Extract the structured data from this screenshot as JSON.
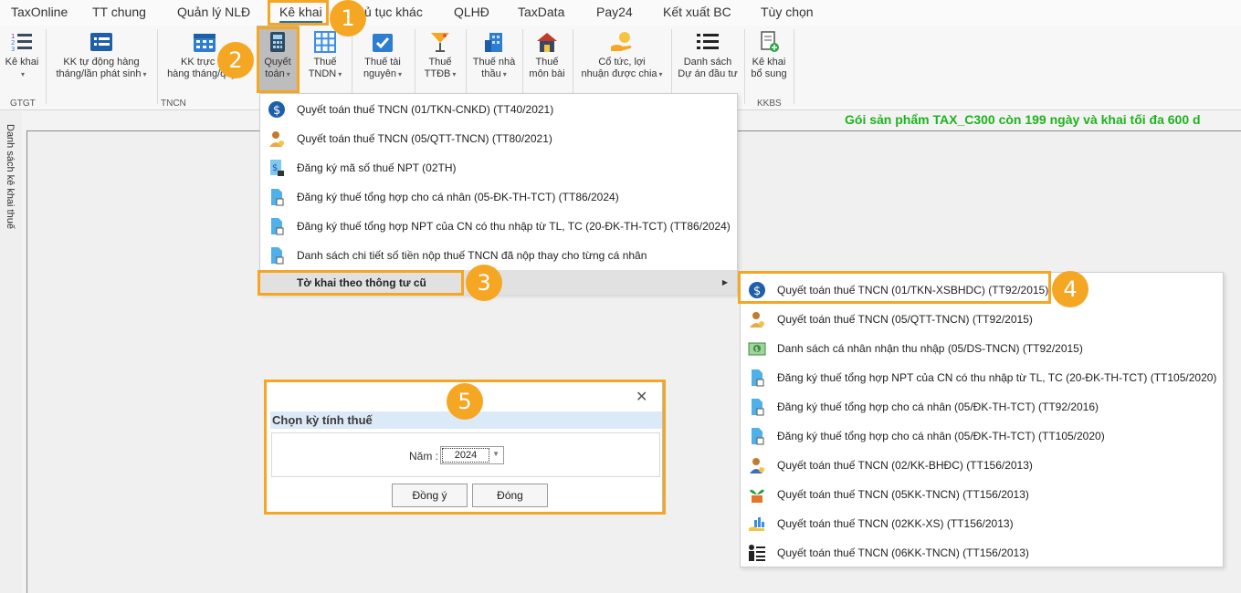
{
  "menubar": {
    "items": [
      "TaxOnline",
      "TT chung",
      "Quản lý NLĐ",
      "Kê khai",
      "ủ tục khác",
      "QLHĐ",
      "TaxData",
      "Pay24",
      "Kết xuất BC",
      "Tùy chọn"
    ]
  },
  "ribbon": {
    "buttons": [
      {
        "line1": "Kê khai",
        "line2": "",
        "icon": "list-numbered-icon"
      },
      {
        "line1": "KK tự động hàng",
        "line2": "tháng/lần phát sinh",
        "icon": "calendar-list-icon"
      },
      {
        "line1": "KK trực tiế",
        "line2": "hàng tháng/quý",
        "icon": "calendar-icon"
      },
      {
        "line1": "Quyết",
        "line2": "toán",
        "icon": "calculator-icon"
      },
      {
        "line1": "Thuế",
        "line2": "TNDN",
        "icon": "grid-icon"
      },
      {
        "line1": "Thuế tài",
        "line2": "nguyên",
        "icon": "calendar-check-icon"
      },
      {
        "line1": "Thuế",
        "line2": "TTĐB",
        "icon": "cocktail-icon"
      },
      {
        "line1": "Thuế nhà",
        "line2": "thầu",
        "icon": "building-icon"
      },
      {
        "line1": "Thuế",
        "line2": "môn bài",
        "icon": "house-icon"
      },
      {
        "line1": "Cổ tức, lợi",
        "line2": "nhuận được chia",
        "icon": "hand-coin-icon"
      },
      {
        "line1": "Danh sách",
        "line2": "Dự án đầu tư",
        "icon": "list-icon"
      },
      {
        "line1": "Kê khai",
        "line2": "bổ sung",
        "icon": "document-add-icon"
      }
    ],
    "groups": [
      "GTGT",
      "TNCN",
      "KKBS"
    ]
  },
  "side_panel": {
    "label": "Danh sách kê khai thuế"
  },
  "promo": "Gói sản phẩm TAX_C300 còn 199 ngày và khai tối đa 600 d",
  "dropdown": {
    "items": [
      {
        "label": "Quyết toán thuế TNCN (01/TKN-CNKD) (TT40/2021)",
        "icon": "dollar-circle-icon"
      },
      {
        "label": "Quyết toán thuế TNCN (05/QTT-TNCN) (TT80/2021)",
        "icon": "person-icon"
      },
      {
        "label": "Đăng ký mã số thuế NPT (02TH)",
        "icon": "document-dollar-icon"
      },
      {
        "label": "Đăng ký thuế tổng hợp cho cá nhân (05-ĐK-TH-TCT) (TT86/2024)",
        "icon": "document-icon"
      },
      {
        "label": "Đăng ký thuế tổng hợp NPT của CN có thu nhập từ TL, TC (20-ĐK-TH-TCT) (TT86/2024)",
        "icon": "document-icon"
      },
      {
        "label": "Danh sách chi tiết số tiền nộp thuế TNCN đã nộp thay cho từng cá nhân",
        "icon": "document-icon"
      },
      {
        "label": "Tờ khai theo thông tư cũ",
        "icon": ""
      }
    ]
  },
  "submenu": {
    "items": [
      {
        "label": "Quyết toán thuế TNCN (01/TKN-XSBHDC) (TT92/2015)",
        "icon": "dollar-circle-icon"
      },
      {
        "label": "Quyết toán thuế TNCN (05/QTT-TNCN) (TT92/2015)",
        "icon": "person-icon"
      },
      {
        "label": "Danh sách cá nhân nhận thu nhập (05/DS-TNCN) (TT92/2015)",
        "icon": "money-icon"
      },
      {
        "label": "Đăng ký thuế tổng hợp NPT của CN có thu nhập từ TL, TC (20-ĐK-TH-TCT) (TT105/2020)",
        "icon": "document-icon"
      },
      {
        "label": "Đăng ký thuế tổng hợp cho cá nhân (05/ĐK-TH-TCT) (TT92/2016)",
        "icon": "document-icon"
      },
      {
        "label": "Đăng ký thuế tổng hợp cho cá nhân (05/ĐK-TH-TCT) (TT105/2020)",
        "icon": "document-icon"
      },
      {
        "label": "Quyết toán thuế TNCN (02/KK-BHĐC) (TT156/2013)",
        "icon": "person-icon"
      },
      {
        "label": "Quyết toán thuế TNCN (05KK-TNCN) (TT156/2013)",
        "icon": "plant-icon"
      },
      {
        "label": "Quyết toán thuế TNCN (02KK-XS) (TT156/2013)",
        "icon": "hand-chart-icon"
      },
      {
        "label": "Quyết toán thuế TNCN (06KK-TNCN) (TT156/2013)",
        "icon": "people-list-icon"
      }
    ]
  },
  "dialog": {
    "title": "Chọn kỳ tính thuế",
    "close": "✕",
    "year_label": "Năm :",
    "year_value": "2024",
    "ok_label": "Đồng ý",
    "close_label": "Đóng"
  },
  "callouts": [
    "1",
    "2",
    "3",
    "4",
    "5"
  ],
  "colors": {
    "callout": "#f5a623",
    "promo": "#1db31d",
    "dialog_header": "#dce9f6",
    "accent_blue": "#1f6fb7"
  }
}
